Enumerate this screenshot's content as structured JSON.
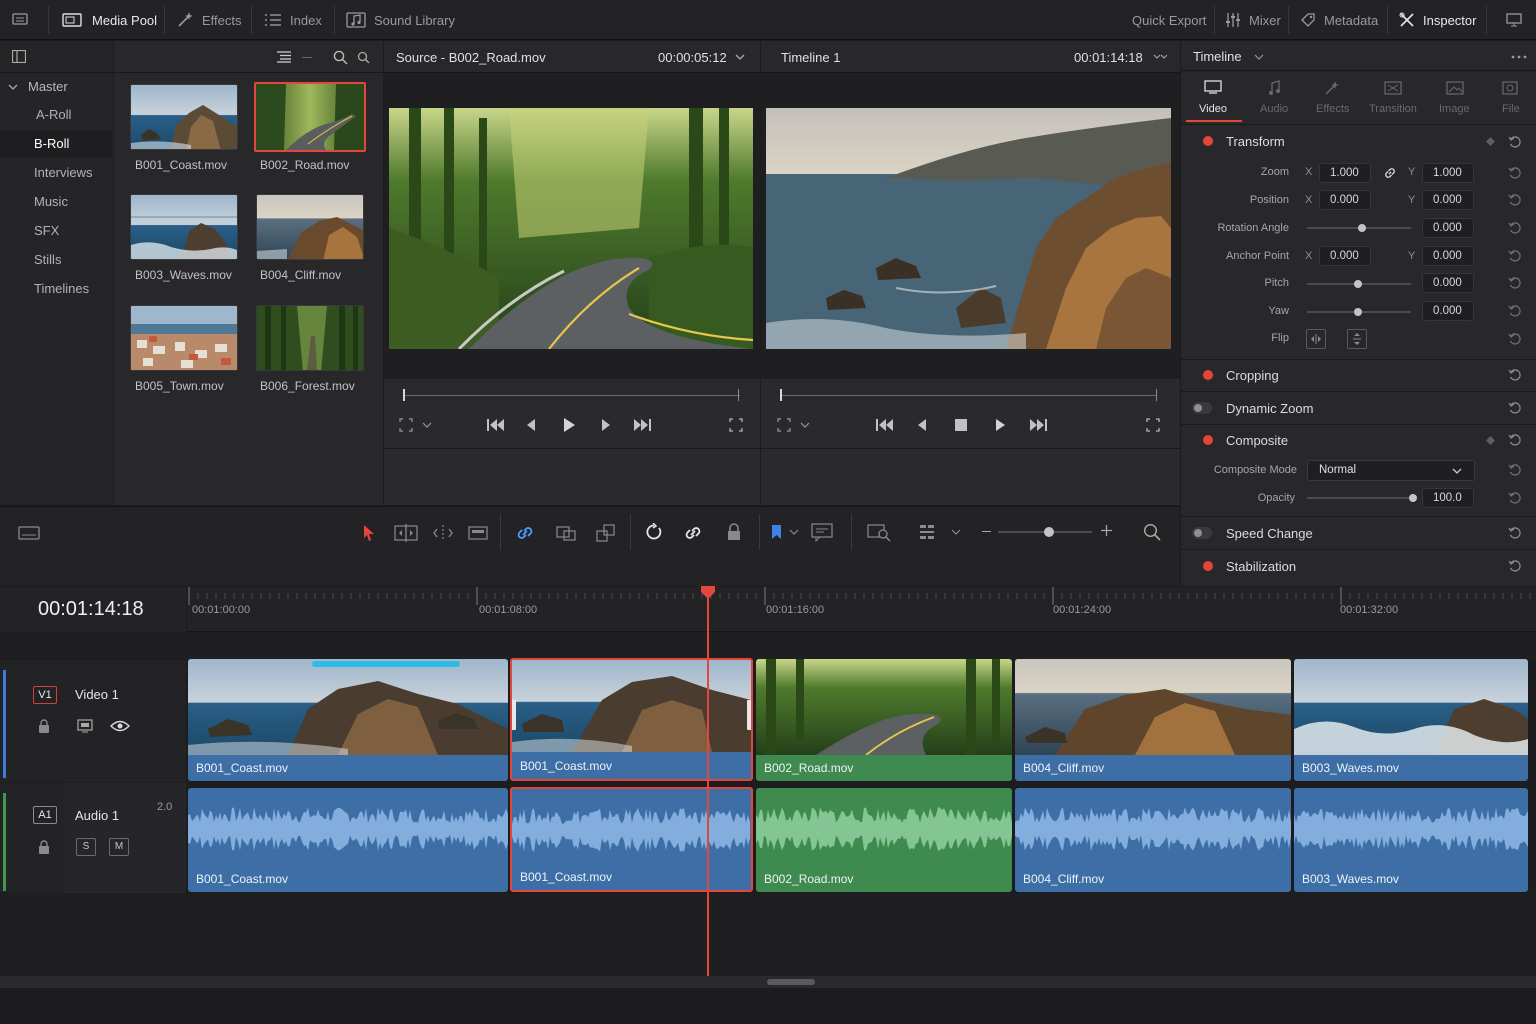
{
  "topbar": {
    "media_pool": "Media Pool",
    "effects": "Effects",
    "index": "Index",
    "sound_library": "Sound Library",
    "quick_export": "Quick Export",
    "mixer": "Mixer",
    "metadata": "Metadata",
    "inspector": "Inspector"
  },
  "bins": {
    "master": "Master",
    "items": [
      "A-Roll",
      "B-Roll",
      "Interviews",
      "Music",
      "SFX",
      "Stills",
      "Timelines"
    ],
    "selected": "B-Roll"
  },
  "clips_grid": [
    "B001_Coast.mov",
    "B002_Road.mov",
    "B003_Waves.mov",
    "B004_Cliff.mov",
    "B005_Town.mov",
    "B006_Forest.mov"
  ],
  "source_viewer": {
    "title": "Source - B002_Road.mov",
    "timecode": "00:00:05:12"
  },
  "timeline_viewer": {
    "title": "Timeline 1",
    "timecode": "00:01:14:18"
  },
  "inspector": {
    "header": "Timeline",
    "tabs": [
      "Video",
      "Audio",
      "Effects",
      "Transition",
      "Image",
      "File"
    ],
    "transform": {
      "title": "Transform",
      "zoom_label": "Zoom",
      "zoom_x": "1.000",
      "zoom_y": "1.000",
      "position_label": "Position",
      "position_x": "0.000",
      "position_y": "0.000",
      "rotation_label": "Rotation Angle",
      "rotation": "0.000",
      "anchor_label": "Anchor Point",
      "anchor_x": "0.000",
      "anchor_y": "0.000",
      "pitch_label": "Pitch",
      "pitch": "0.000",
      "yaw_label": "Yaw",
      "yaw": "0.000",
      "flip_label": "Flip",
      "x": "X",
      "y": "Y"
    },
    "cropping": "Cropping",
    "dynamic_zoom": "Dynamic Zoom",
    "composite": {
      "title": "Composite",
      "mode_label": "Composite Mode",
      "mode_value": "Normal",
      "opacity_label": "Opacity",
      "opacity_value": "100.0"
    },
    "speed_change": "Speed Change",
    "stabilization": "Stabilization"
  },
  "timeline": {
    "current_timecode": "00:01:14:18",
    "ruler": [
      "00:01:00:00",
      "00:01:08:00",
      "00:01:16:00",
      "00:01:24:00",
      "00:01:32:00"
    ],
    "video_track": {
      "id": "V1",
      "name": "Video 1"
    },
    "audio_track": {
      "id": "A1",
      "name": "Audio 1",
      "channels": "2.0",
      "solo": "S",
      "mute": "M"
    },
    "video_clips": [
      "B001_Coast.mov",
      "B001_Coast.mov",
      "B002_Road.mov",
      "B004_Cliff.mov",
      "B003_Waves.mov"
    ],
    "audio_clips": [
      "B001_Coast.mov",
      "B001_Coast.mov",
      "B002_Road.mov",
      "B004_Cliff.mov",
      "B003_Waves.mov"
    ]
  },
  "colors": {
    "accent_red": "#e2473b",
    "clip_blue": "#3d6ea6",
    "clip_green": "#3f8a4e",
    "link_blue": "#4a9eff"
  }
}
